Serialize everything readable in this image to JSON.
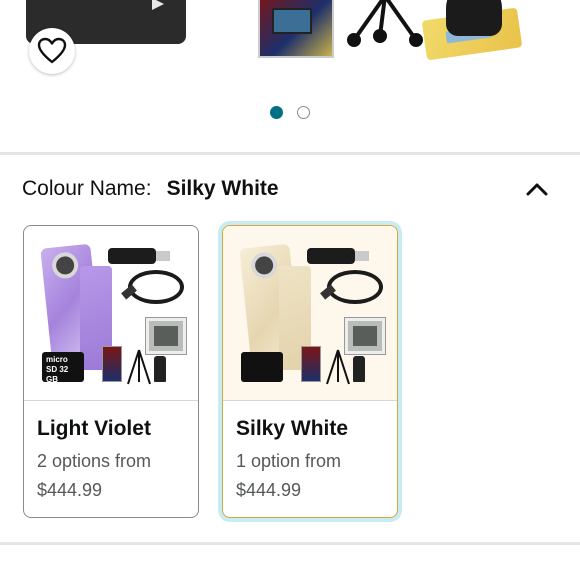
{
  "carousel": {
    "dots": [
      {
        "active": true
      },
      {
        "active": false
      }
    ]
  },
  "variation": {
    "label": "Colour Name:",
    "selected": "Silky White"
  },
  "options": [
    {
      "name": "Light Violet",
      "availability": "2 options from",
      "price": "$444.99",
      "selected": false,
      "sd_text": "micro SD 32 GB"
    },
    {
      "name": "Silky White",
      "availability": "1 option from",
      "price": "$444.99",
      "selected": true
    }
  ],
  "colors": {
    "accent": "#007185",
    "selected_border": "#d6a63f",
    "selected_glow": "#c8ecf2",
    "violet_body": "#b79ae0",
    "white_body": "#efe3c6"
  },
  "icons": {
    "wishlist": "heart-icon",
    "collapse": "chevron-up-icon"
  }
}
